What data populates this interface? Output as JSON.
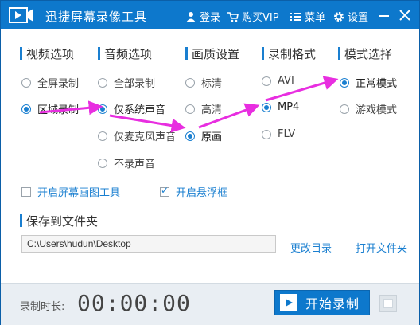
{
  "app": {
    "title": "迅捷屏幕录像工具",
    "login": "登录",
    "vip": "购买VIP",
    "menu": "菜单",
    "settings": "设置"
  },
  "sections": {
    "video": {
      "title": "视频选项",
      "options": [
        "全屏录制",
        "区域录制"
      ],
      "selected": "区域录制"
    },
    "audio": {
      "title": "音频选项",
      "options": [
        "全部录制",
        "仅系统声音",
        "仅麦克风声音",
        "不录声音"
      ],
      "selected": "仅系统声音"
    },
    "quality": {
      "title": "画质设置",
      "options": [
        "标清",
        "高清",
        "原画"
      ],
      "selected": "原画"
    },
    "format": {
      "title": "录制格式",
      "options": [
        "AVI",
        "MP4",
        "FLV"
      ],
      "selected": "MP4"
    },
    "mode": {
      "title": "模式选择",
      "options": [
        "正常模式",
        "游戏模式"
      ],
      "selected": "正常模式"
    }
  },
  "checkboxes": {
    "draw_tool": {
      "label": "开启屏幕画图工具",
      "checked": false
    },
    "floating_window": {
      "label": "开启悬浮框",
      "checked": true
    }
  },
  "save": {
    "title": "保存到文件夹",
    "path": "C:\\Users\\hudun\\Desktop",
    "change_dir": "更改目录",
    "open_folder": "打开文件夹"
  },
  "footer": {
    "duration_label": "录制时长:",
    "duration_value": "00:00:00",
    "start_label": "开始录制"
  },
  "colors": {
    "titlebar": "#0d78cc",
    "accent": "#1a7fd0",
    "annotation_arrow": "#e82ee0"
  }
}
